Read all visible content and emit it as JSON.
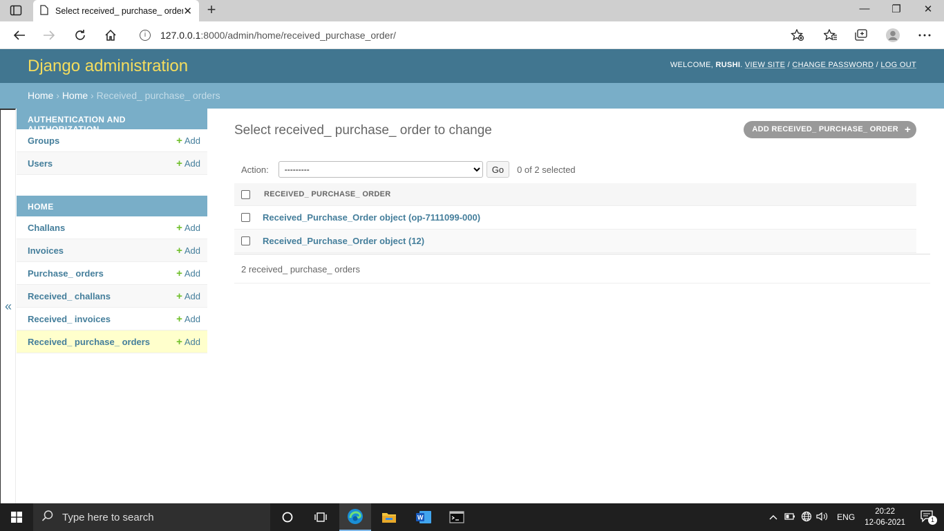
{
  "browser": {
    "tab_title": "Select received_ purchase_ order",
    "tab_close": "✕",
    "new_tab": "+",
    "url_host": "127.0.0.1",
    "url_rest": ":8000/admin/home/received_purchase_order/",
    "window_controls": {
      "minimize": "—",
      "restore": "❐",
      "close": "✕"
    }
  },
  "header": {
    "branding": "Django administration",
    "welcome": "WELCOME, ",
    "username": "RUSHI",
    "period": ". ",
    "view_site": "VIEW SITE",
    "sep1": " / ",
    "change_password": "CHANGE PASSWORD",
    "sep2": " / ",
    "log_out": "LOG OUT"
  },
  "breadcrumbs": {
    "home": "Home",
    "sep": " › ",
    "app": "Home",
    "current": "Received_ purchase_ orders"
  },
  "nav_toggle": "«",
  "sidebar": {
    "modules": [
      {
        "caption": "Authentication and Authorization",
        "models": [
          {
            "name": "Groups",
            "add": "Add"
          },
          {
            "name": "Users",
            "add": "Add"
          }
        ]
      },
      {
        "caption": "Home",
        "models": [
          {
            "name": "Challans",
            "add": "Add"
          },
          {
            "name": "Invoices",
            "add": "Add"
          },
          {
            "name": "Purchase_ orders",
            "add": "Add"
          },
          {
            "name": "Received_ challans",
            "add": "Add"
          },
          {
            "name": "Received_ invoices",
            "add": "Add"
          },
          {
            "name": "Received_ purchase_ orders",
            "add": "Add"
          }
        ]
      }
    ],
    "plus": "+"
  },
  "content": {
    "title": "Select received_ purchase_ order to change",
    "add_button": "ADD RECEIVED_ PURCHASE_ ORDER",
    "add_plus": "+",
    "action_label": "Action:",
    "action_selected": "---------",
    "go": "Go",
    "selected_count": "0 of 2 selected",
    "column_header": "RECEIVED_ PURCHASE_ ORDER",
    "rows": [
      "Received_Purchase_Order object (op-7111099-000)",
      "Received_Purchase_Order object (12)"
    ],
    "paginator": "2 received_ purchase_ orders"
  },
  "taskbar": {
    "search_placeholder": "Type here to search",
    "language": "ENG",
    "time": "20:22",
    "date": "12-06-2021",
    "notification_count": "1"
  }
}
